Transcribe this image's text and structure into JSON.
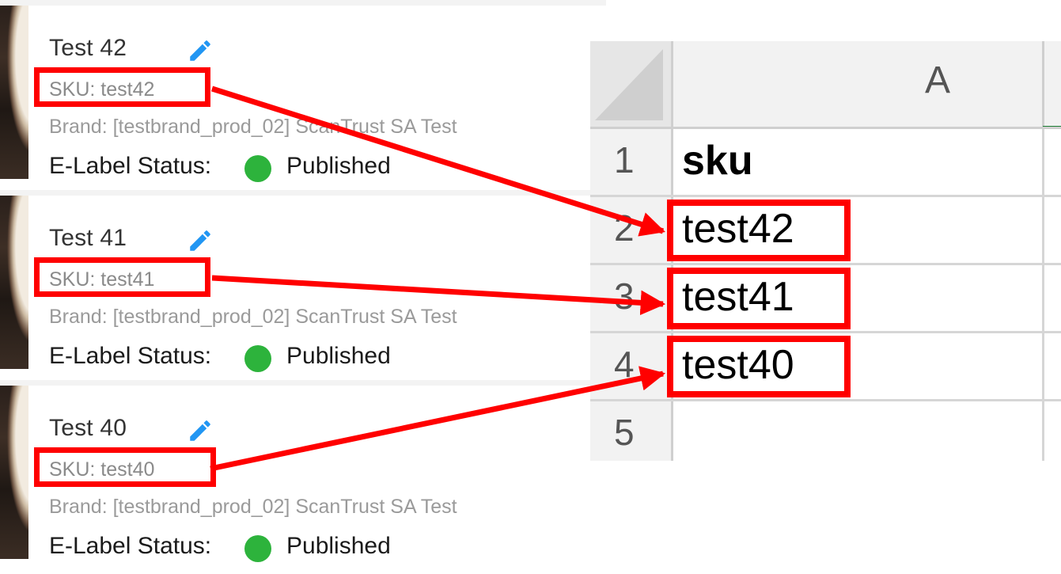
{
  "products": [
    {
      "title": "Test 42",
      "sku": "SKU: test42",
      "brand": "Brand: [testbrand_prod_02] ScanTrust SA Test",
      "status_label": "E-Label Status:",
      "status_value": "Published",
      "status_color": "#2db33c",
      "edit_icon": "pencil-icon"
    },
    {
      "title": "Test 41",
      "sku": "SKU: test41",
      "brand": "Brand: [testbrand_prod_02] ScanTrust SA Test",
      "status_label": "E-Label Status:",
      "status_value": "Published",
      "status_color": "#2db33c",
      "edit_icon": "pencil-icon"
    },
    {
      "title": "Test 40",
      "sku": "SKU: test40",
      "brand": "Brand: [testbrand_prod_02] ScanTrust SA Test",
      "status_label": "E-Label Status:",
      "status_value": "Published",
      "status_color": "#2db33c",
      "edit_icon": "pencil-icon"
    }
  ],
  "spreadsheet": {
    "column_header": "A",
    "rows": [
      {
        "num": "1",
        "value": "sku"
      },
      {
        "num": "2",
        "value": "test42"
      },
      {
        "num": "3",
        "value": "test41"
      },
      {
        "num": "4",
        "value": "test40"
      },
      {
        "num": "5",
        "value": ""
      }
    ]
  },
  "annotation": {
    "highlight_color": "#ff0000",
    "links": [
      {
        "from": "SKU: test42",
        "to": "test42"
      },
      {
        "from": "SKU: test41",
        "to": "test41"
      },
      {
        "from": "SKU: test40",
        "to": "test40"
      }
    ]
  }
}
